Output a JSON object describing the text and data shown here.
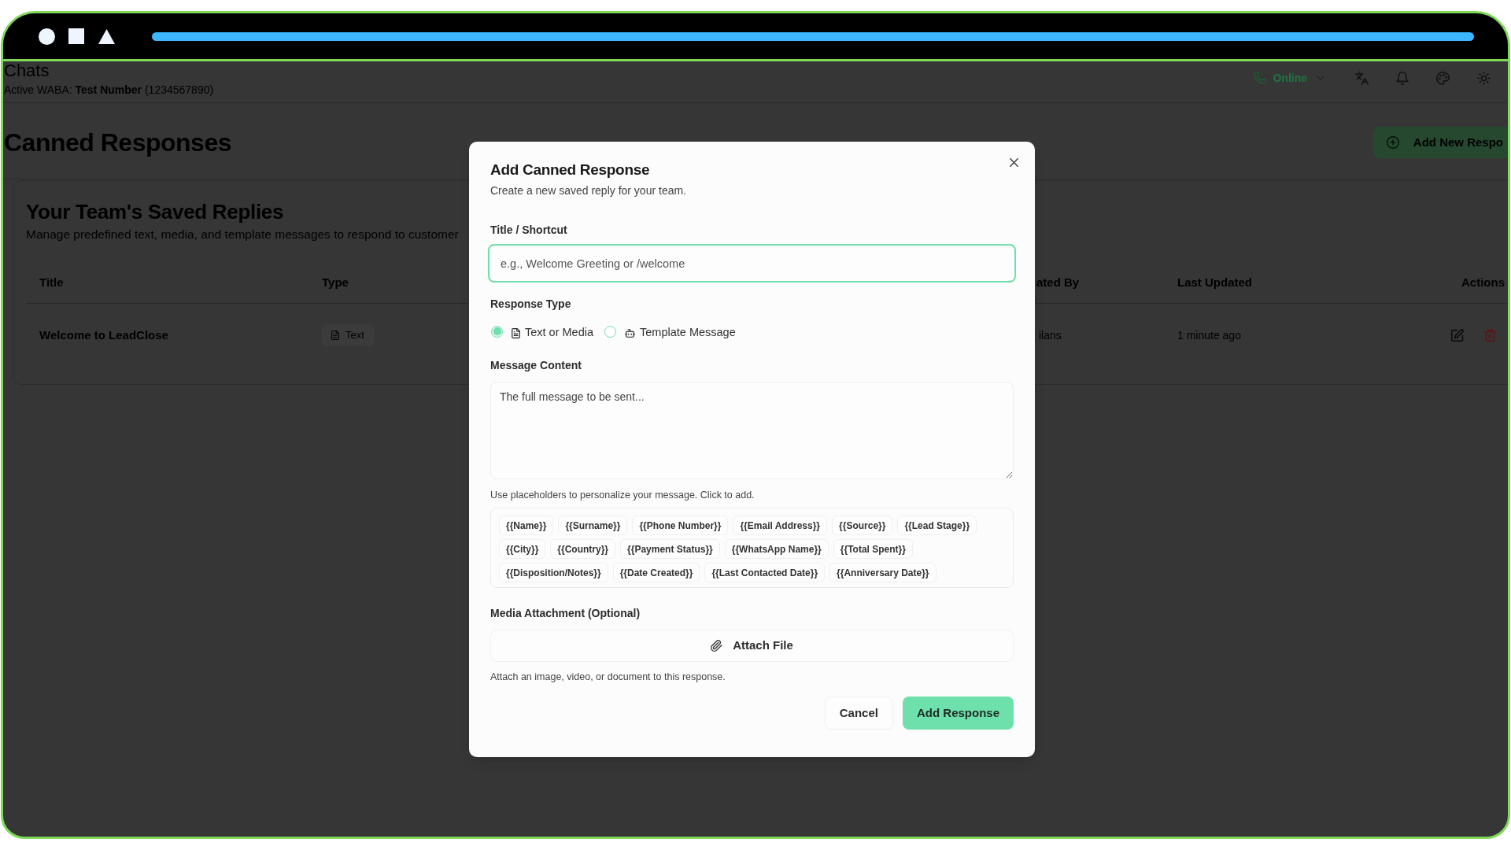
{
  "header": {
    "title": "Chats",
    "subtitle": "Active WABA: **Test Number** (1234567890)",
    "status": "Online"
  },
  "page": {
    "title": "Canned Responses",
    "add_button": "Add New Respo"
  },
  "card": {
    "title": "Your Team's Saved Replies",
    "description": "Manage predefined text, media, and template messages to respond to customer"
  },
  "table": {
    "columns": [
      "Title",
      "Type",
      "ated By",
      "Last Updated",
      "Actions"
    ],
    "rows": [
      {
        "title": "Welcome to LeadClose",
        "type": "Text",
        "created_by": "ilans",
        "last_updated": "1 minute ago"
      }
    ]
  },
  "modal": {
    "title": "Add Canned Response",
    "subtitle": "Create a new saved reply for your team.",
    "title_field": {
      "label": "Title / Shortcut",
      "placeholder": "e.g., Welcome Greeting or /welcome",
      "focused": true
    },
    "response_type": {
      "label": "Response Type",
      "options": [
        {
          "label": "Text or Media",
          "kind": "media",
          "selected": true
        },
        {
          "label": "Template Message",
          "kind": "template",
          "selected": false
        }
      ]
    },
    "message_field": {
      "label": "Message Content",
      "placeholder": "The full message to be sent..."
    },
    "placeholder_hint": "Use placeholders to personalize your message. Click to add.",
    "placeholders": [
      "{{Name}}",
      "{{Surname}}",
      "{{Phone Number}}",
      "{{Email Address}}",
      "{{Source}}",
      "{{Lead Stage}}",
      "{{City}}",
      "{{Country}}",
      "{{Payment Status}}",
      "{{WhatsApp Name}}",
      "{{Total Spent}}",
      "{{Disposition/Notes}}",
      "{{Date Created}}",
      "{{Last Contacted Date}}",
      "{{Anniversary Date}}"
    ],
    "media": {
      "label": "Media Attachment (Optional)",
      "button": "Attach File",
      "hint": "Attach an image, video, or document to this response."
    },
    "buttons": [
      {
        "label": "Cancel",
        "kind": "secondary"
      },
      {
        "label": "Add Response",
        "kind": "primary"
      }
    ]
  }
}
